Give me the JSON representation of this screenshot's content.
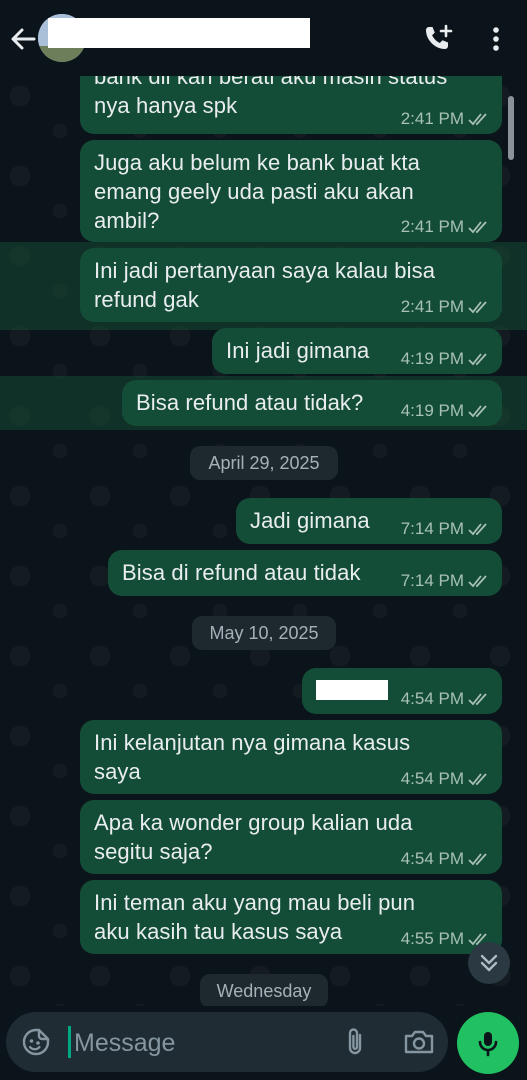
{
  "header": {
    "back_icon": "arrow-left-icon",
    "call_icon": "add-call-icon",
    "menu_icon": "more-vertical-icon"
  },
  "messages": [
    {
      "text": "bank dll kan berati aku masih status\nnya hanya spk",
      "time": "2:41 PM"
    },
    {
      "text": "Juga aku belum ke bank buat kta\nemang geely uda pasti aku akan\nambil?",
      "time": "2:41 PM"
    },
    {
      "text": "Ini jadi pertanyaan saya kalau bisa\nrefund gak",
      "time": "2:41 PM"
    },
    {
      "text": "Ini jadi gimana",
      "time": "4:19 PM"
    },
    {
      "text": "Bisa refund atau tidak?",
      "time": "4:19 PM"
    },
    {
      "text": "Jadi gimana",
      "time": "7:14 PM"
    },
    {
      "text": "Bisa di refund atau tidak",
      "time": "7:14 PM"
    },
    {
      "text": "",
      "time": "4:54 PM"
    },
    {
      "text": "Ini kelanjutan nya gimana kasus\nsaya",
      "time": "4:54 PM"
    },
    {
      "text": "Apa ka wonder group kalian uda\nsegitu saja?",
      "time": "4:54 PM"
    },
    {
      "text": "Ini teman aku yang mau beli pun\naku kasih tau kasus saya",
      "time": "4:55 PM"
    }
  ],
  "dates": [
    "April 29, 2025",
    "May 10, 2025",
    "Wednesday"
  ],
  "composer": {
    "placeholder": "Message",
    "emoji_icon": "sticker-emoji-icon",
    "attach_icon": "paperclip-icon",
    "camera_icon": "camera-icon",
    "mic_icon": "microphone-icon"
  },
  "colors": {
    "background": "#0b141a",
    "outgoing_bubble": "#144d37",
    "accent": "#21c063",
    "highlight": "#185a3a"
  }
}
